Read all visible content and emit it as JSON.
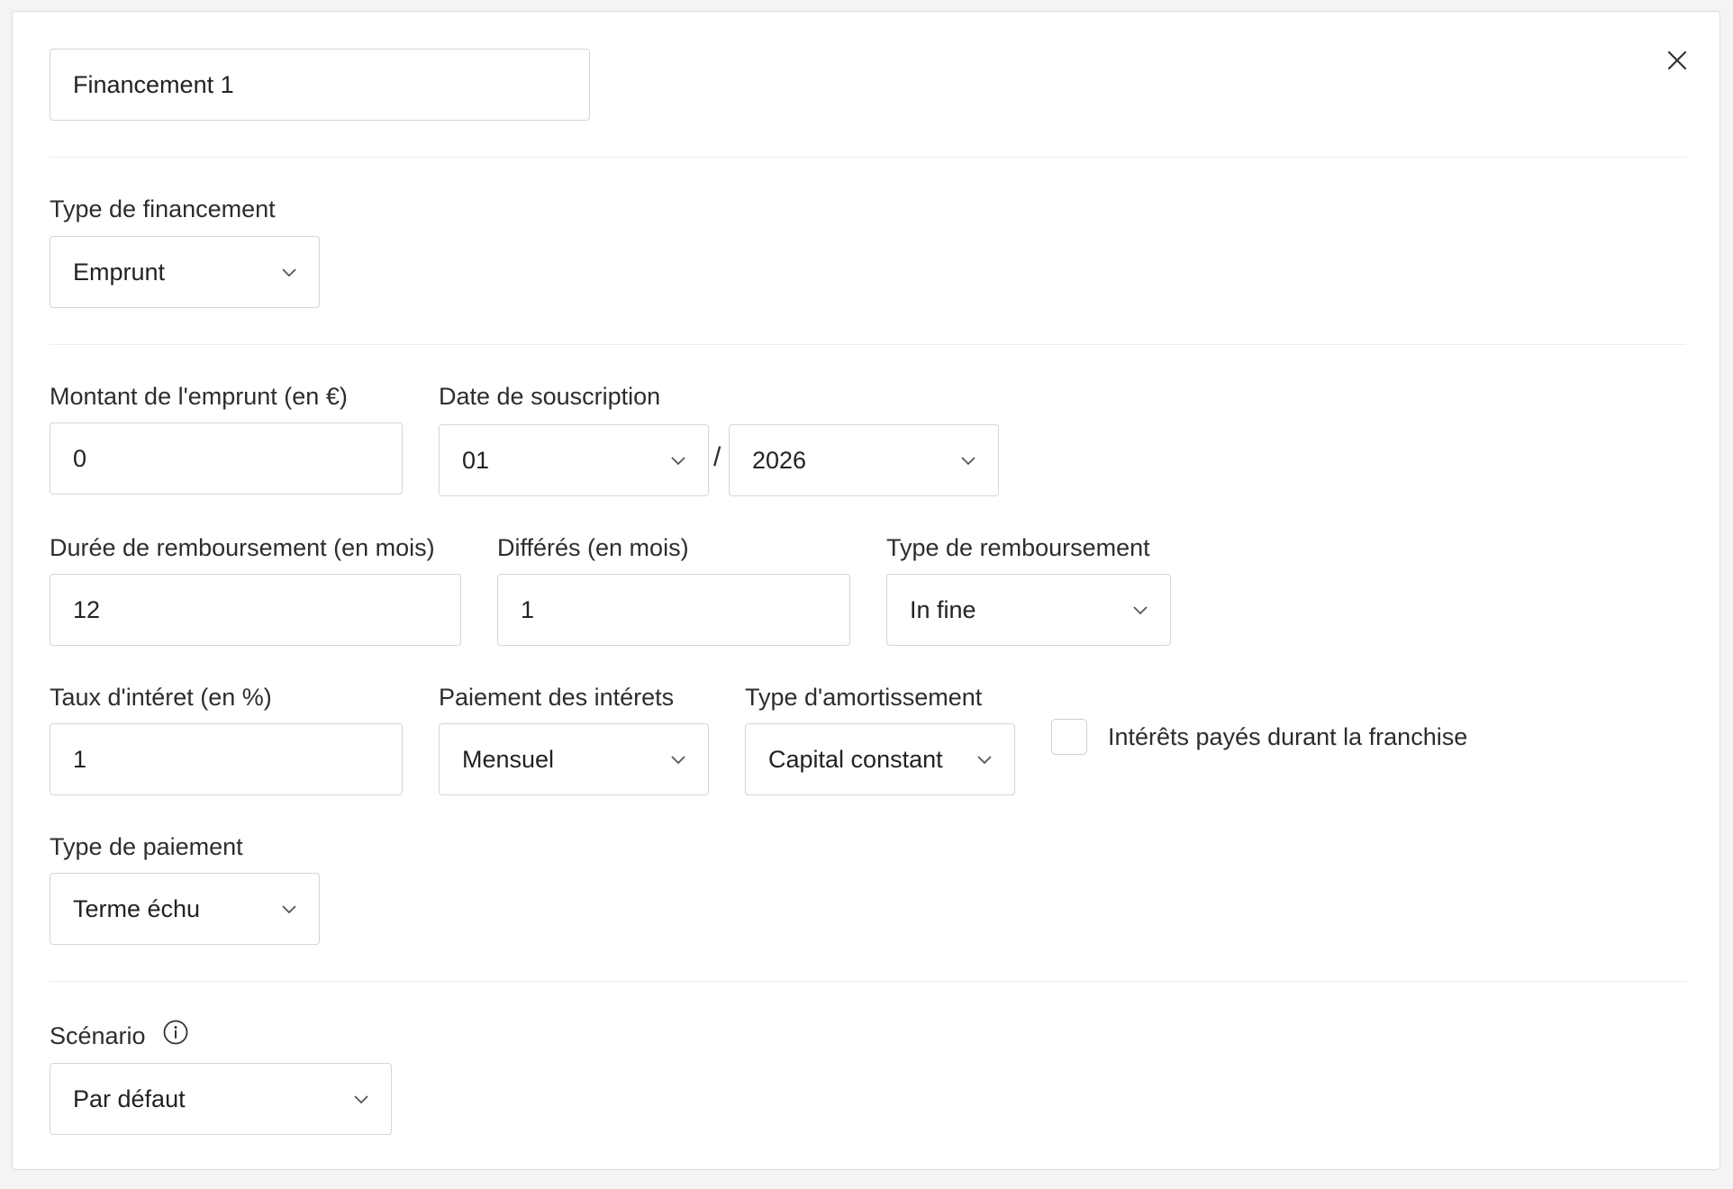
{
  "header": {
    "name_value": "Financement 1"
  },
  "financing_type": {
    "label": "Type de financement",
    "value": "Emprunt"
  },
  "loan_amount": {
    "label": "Montant de l'emprunt (en €)",
    "value": "0"
  },
  "subscription_date": {
    "label": "Date de souscription",
    "month": "01",
    "separator": "/",
    "year": "2026"
  },
  "repayment_duration": {
    "label": "Durée de remboursement (en mois)",
    "value": "12"
  },
  "deferrals": {
    "label": "Différés (en mois)",
    "value": "1"
  },
  "repayment_type": {
    "label": "Type de remboursement",
    "value": "In fine"
  },
  "interest_rate": {
    "label": "Taux d'intéret (en %)",
    "value": "1"
  },
  "interest_payment": {
    "label": "Paiement des intérets",
    "value": "Mensuel"
  },
  "amortization_type": {
    "label": "Type d'amortissement",
    "value": "Capital constant"
  },
  "interest_during_grace": {
    "label": "Intérêts payés durant la franchise",
    "checked": false
  },
  "payment_type": {
    "label": "Type de paiement",
    "value": "Terme échu"
  },
  "scenario": {
    "label": "Scénario",
    "value": "Par défaut"
  },
  "icons": {
    "close": "close-icon",
    "chevron": "chevron-down-icon",
    "info": "info-icon"
  },
  "colors": {
    "border": "#d6d6d6",
    "text": "#222222",
    "divider": "#ececec",
    "background": "#ffffff"
  }
}
